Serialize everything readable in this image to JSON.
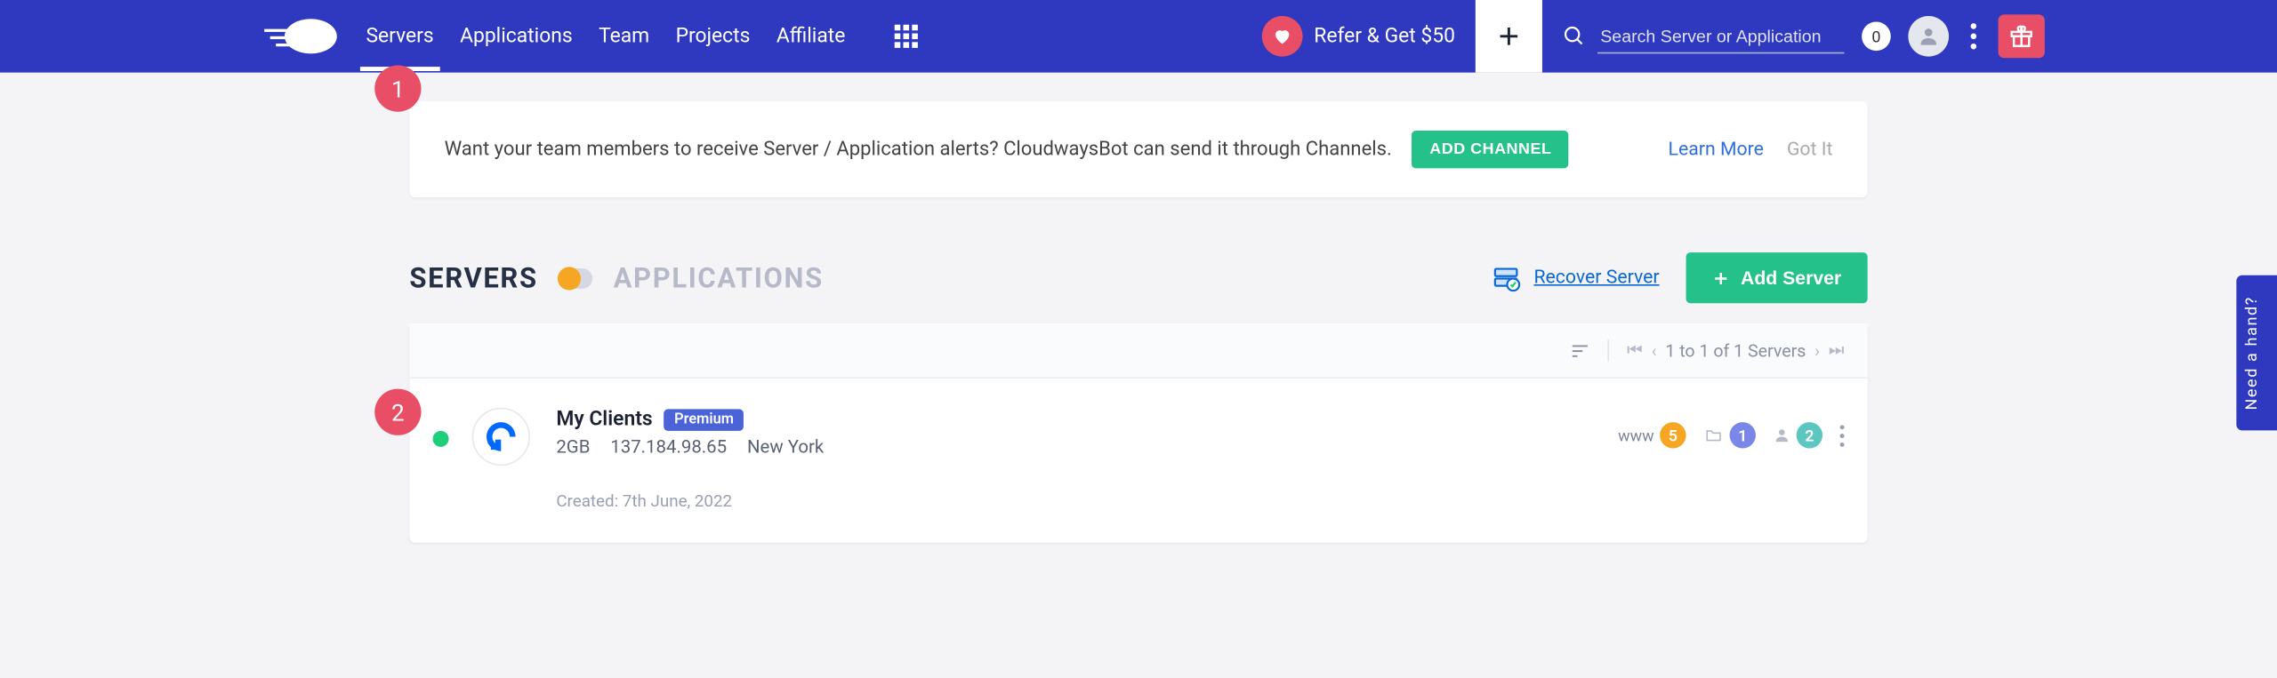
{
  "header": {
    "nav": [
      "Servers",
      "Applications",
      "Team",
      "Projects",
      "Affiliate"
    ],
    "refer": "Refer & Get $50",
    "search_placeholder": "Search Server or Application",
    "counter": "0"
  },
  "banner": {
    "message": "Want your team members to receive Server / Application alerts? CloudwaysBot can send it through Channels.",
    "add_channel": "ADD CHANNEL",
    "learn_more": "Learn More",
    "got_it": "Got It"
  },
  "tabs": {
    "servers": "SERVERS",
    "applications": "APPLICATIONS",
    "recover": "Recover Server",
    "add_server": "Add Server"
  },
  "pager": {
    "text": "1 to 1 of 1 Servers"
  },
  "server": {
    "name": "My Clients",
    "badge": "Premium",
    "size": "2GB",
    "ip": "137.184.98.65",
    "location": "New York",
    "created": "Created: 7th June, 2022",
    "www_count": "5",
    "proj_count": "1",
    "user_count": "2",
    "www_label": "www"
  },
  "annotations": {
    "a1": "1",
    "a2": "2"
  },
  "help_tab": "Need a hand?"
}
